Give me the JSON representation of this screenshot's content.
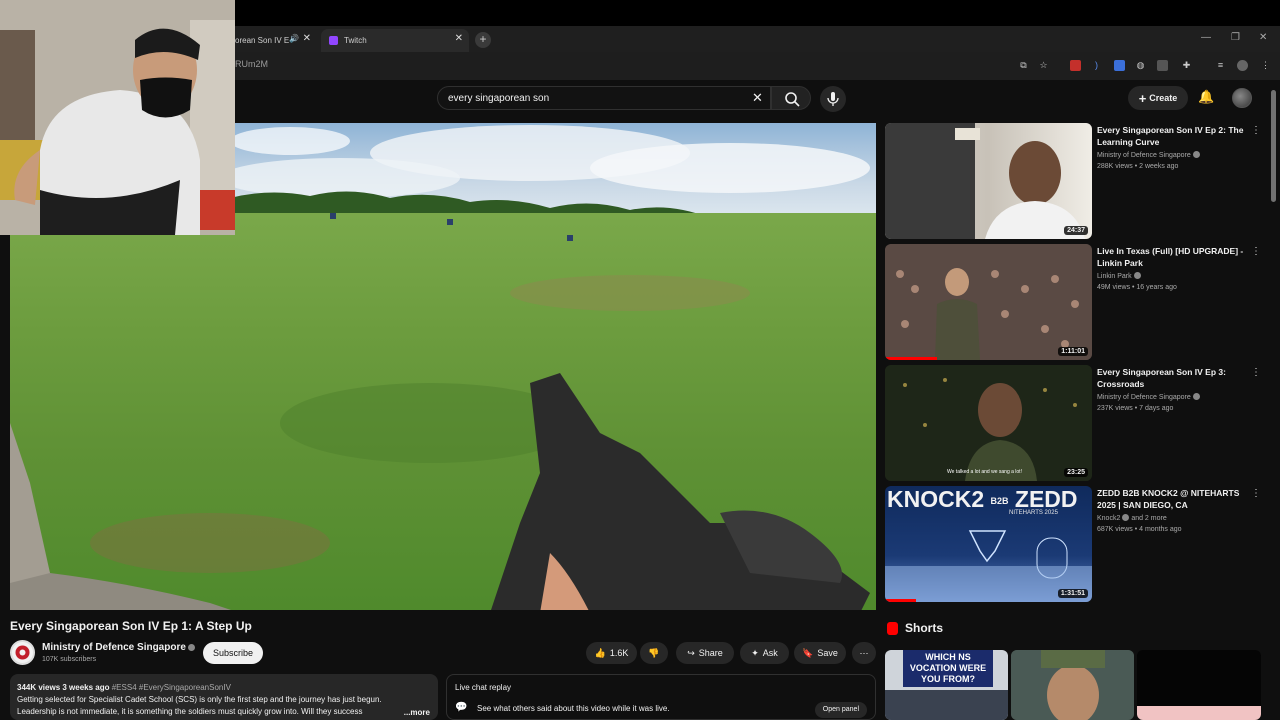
{
  "browser": {
    "tabs": [
      {
        "label": "orean Son IV E"
      },
      {
        "label": "Twitch"
      }
    ],
    "url_fragment": "RUm2M"
  },
  "youtube": {
    "search": {
      "query": "every singaporean son"
    },
    "create_label": "Create"
  },
  "video": {
    "title": "Every Singaporean Son IV Ep 1: A Step Up",
    "channel": "Ministry of Defence Singapore",
    "subscribers": "107K subscribers",
    "subscribe_label": "Subscribe",
    "likes": "1.6K",
    "share_label": "Share",
    "ask_label": "Ask",
    "save_label": "Save"
  },
  "description": {
    "meta": "344K views  3 weeks ago",
    "tags": "#ESS4 #EverySingaporeanSonIV",
    "line1": "Getting selected for Specialist Cadet School (SCS) is only the first step and the journey has just begun.",
    "line2": "Leadership is not immediate, it is something the soldiers must quickly grow into. Will they success",
    "more_label": "...more"
  },
  "live_chat": {
    "title": "Live chat replay",
    "desc": "See what others said about this video while it was live.",
    "button": "Open panel"
  },
  "recommendations": [
    {
      "title": "Every Singaporean Son IV Ep 2: The Learning Curve",
      "channel": "Ministry of Defence Singapore",
      "views": "288K views • 2 weeks ago",
      "duration": "24:37",
      "thumb_color": "#d9d6cf"
    },
    {
      "title": "Live In Texas (Full) [HD UPGRADE] - Linkin Park",
      "channel": "Linkin Park",
      "views": "49M views • 16 years ago",
      "duration": "1:11:01",
      "thumb_color": "#3b3b3b",
      "progress": 0.25
    },
    {
      "title": "Every Singaporean Son IV Ep 3: Crossroads",
      "channel": "Ministry of Defence Singapore",
      "views": "237K views • 7 days ago",
      "duration": "23:25",
      "thumb_color": "#1d2416"
    },
    {
      "title": "ZEDD B2B KNOCK2 @ NITEHARTS 2025 | SAN DIEGO, CA",
      "channel": "Knock2",
      "channel_extra": "and 2 more",
      "views": "687K views • 4 months ago",
      "duration": "1:31:51",
      "thumb_color": "#1b3a75",
      "progress": 0.15
    }
  ],
  "thumb_texts": {
    "rec3_caption": "We talked a lot and we sang a lot!",
    "rec4_line1": "KNOCK2",
    "rec4_b2b": "B2B",
    "rec4_zedd": "ZEDD",
    "rec4_sub": "NITEHARTS 2025"
  },
  "shorts": {
    "label": "Shorts",
    "items": [
      {
        "caption": "WHICH NS VOCATION WERE YOU FROM?"
      },
      {
        "caption": ""
      },
      {
        "caption": ""
      }
    ]
  },
  "colors": {
    "accent": "#ff0000",
    "background": "#0f0f0f",
    "surface": "#272727"
  }
}
